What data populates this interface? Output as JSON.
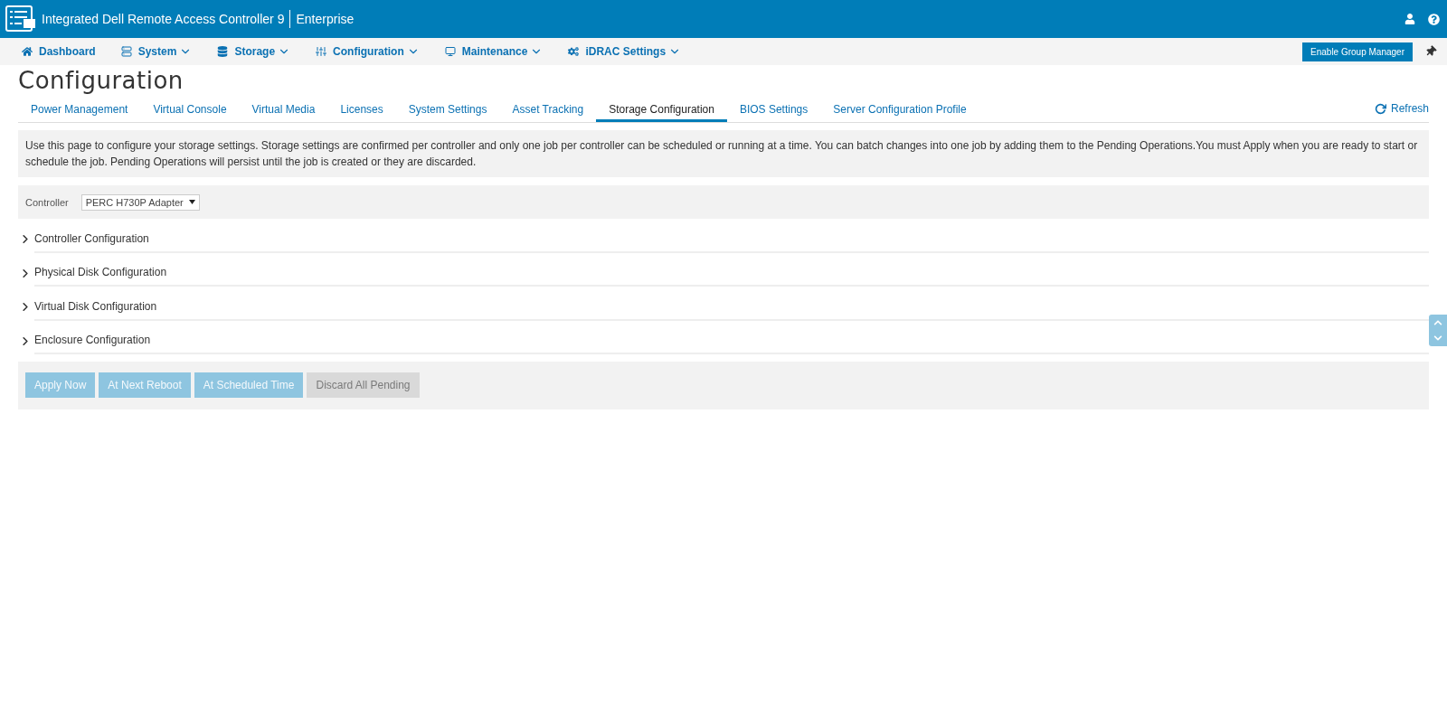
{
  "header": {
    "product": "Integrated Dell Remote Access Controller 9",
    "edition": "Enterprise"
  },
  "nav": {
    "items": [
      {
        "label": "Dashboard",
        "dropdown": false
      },
      {
        "label": "System",
        "dropdown": true
      },
      {
        "label": "Storage",
        "dropdown": true
      },
      {
        "label": "Configuration",
        "dropdown": true
      },
      {
        "label": "Maintenance",
        "dropdown": true
      },
      {
        "label": "iDRAC Settings",
        "dropdown": true
      }
    ],
    "group_button": "Enable Group Manager"
  },
  "page_title": "Configuration",
  "tabs": [
    {
      "label": "Power Management",
      "selected": false
    },
    {
      "label": "Virtual Console",
      "selected": false
    },
    {
      "label": "Virtual Media",
      "selected": false
    },
    {
      "label": "Licenses",
      "selected": false
    },
    {
      "label": "System Settings",
      "selected": false
    },
    {
      "label": "Asset Tracking",
      "selected": false
    },
    {
      "label": "Storage Configuration",
      "selected": true
    },
    {
      "label": "BIOS Settings",
      "selected": false
    },
    {
      "label": "Server Configuration Profile",
      "selected": false
    }
  ],
  "refresh": "Refresh",
  "info": "Use this page to configure your storage settings. Storage settings are confirmed per controller and only one job per controller can be scheduled or running at a time. You can batch changes into one job by adding them to the Pending Operations.You must Apply when you are ready to start or schedule the job. Pending Operations will persist until the job is created or they are discarded.",
  "controller": {
    "label": "Controller",
    "value": "PERC H730P Adapter"
  },
  "sections": [
    {
      "label": "Controller Configuration",
      "expanded": false
    },
    {
      "label": "Physical Disk Configuration",
      "expanded": false
    },
    {
      "label": "Virtual Disk Configuration",
      "expanded": false
    },
    {
      "label": "Enclosure Configuration",
      "expanded": false
    }
  ],
  "actions": [
    {
      "label": "Apply Now",
      "kind": "primary"
    },
    {
      "label": "At Next Reboot",
      "kind": "primary"
    },
    {
      "label": "At Scheduled Time",
      "kind": "primary"
    },
    {
      "label": "Discard All Pending",
      "kind": "neutral"
    }
  ]
}
